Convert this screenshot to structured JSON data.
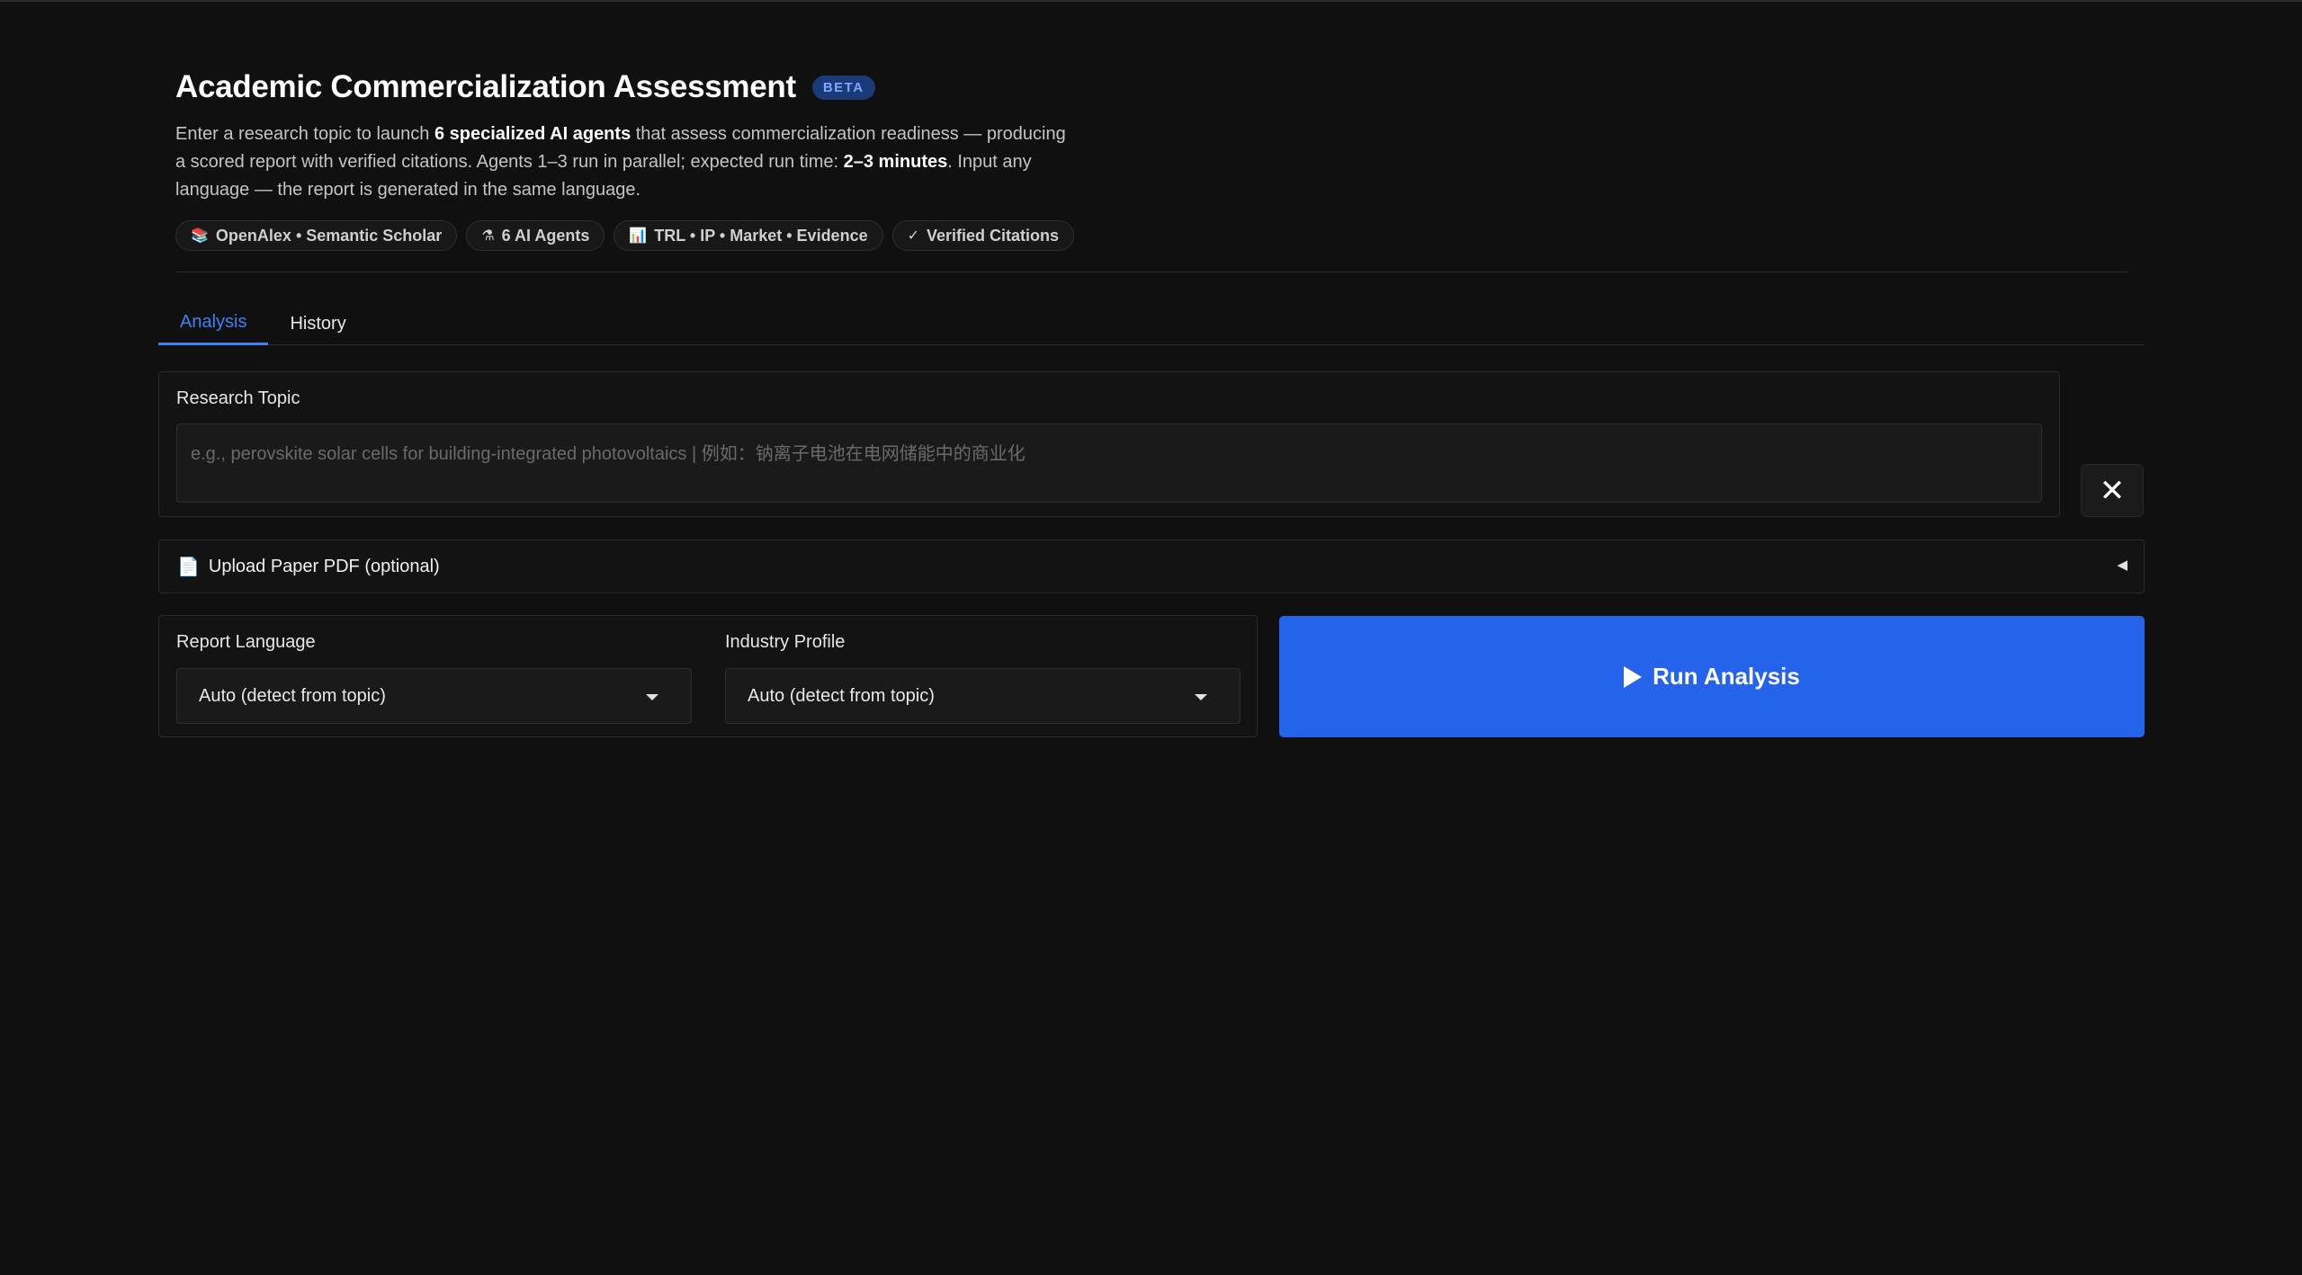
{
  "header": {
    "title": "Academic Commercialization Assessment",
    "badge": "BETA",
    "description": {
      "p1": "Enter a research topic to launch ",
      "b1": "6 specialized AI agents",
      "p2": " that assess commercialization readiness — producing a scored report with verified citations. Agents 1–3 run in parallel; expected run time: ",
      "b2": "2–3 minutes",
      "p3": ". Input any language — the report is generated in the same language."
    },
    "chips": [
      {
        "icon": "books-icon",
        "glyph": "📚",
        "label": "OpenAlex • Semantic Scholar"
      },
      {
        "icon": "flask-icon",
        "glyph": "⚗",
        "label": "6 AI Agents"
      },
      {
        "icon": "bar-chart-icon",
        "glyph": "📊",
        "label": "TRL • IP • Market • Evidence"
      },
      {
        "icon": "check-icon",
        "glyph": "✓",
        "label": "Verified Citations"
      }
    ]
  },
  "tabs": [
    {
      "label": "Analysis",
      "active": true
    },
    {
      "label": "History",
      "active": false
    }
  ],
  "topic": {
    "label": "Research Topic",
    "value": "",
    "placeholder": "e.g., perovskite solar cells for building-integrated photovoltaics | 例如：钠离子电池在电网储能中的商业化"
  },
  "clear_button": {
    "icon": "close-icon",
    "glyph": "✕"
  },
  "upload": {
    "icon": "document-icon",
    "glyph": "📄",
    "label": "Upload Paper PDF (optional)",
    "caret_glyph": "◀"
  },
  "options": {
    "language": {
      "label": "Report Language",
      "value": "Auto (detect from topic)"
    },
    "industry": {
      "label": "Industry Profile",
      "value": "Auto (detect from topic)"
    }
  },
  "run_button": {
    "label": "Run Analysis",
    "icon": "play-icon"
  },
  "colors": {
    "background": "#101010",
    "accent": "#2563eb",
    "tab_active": "#3b82f6",
    "badge_bg": "#1b3a78",
    "badge_text": "#7fa6ff"
  }
}
